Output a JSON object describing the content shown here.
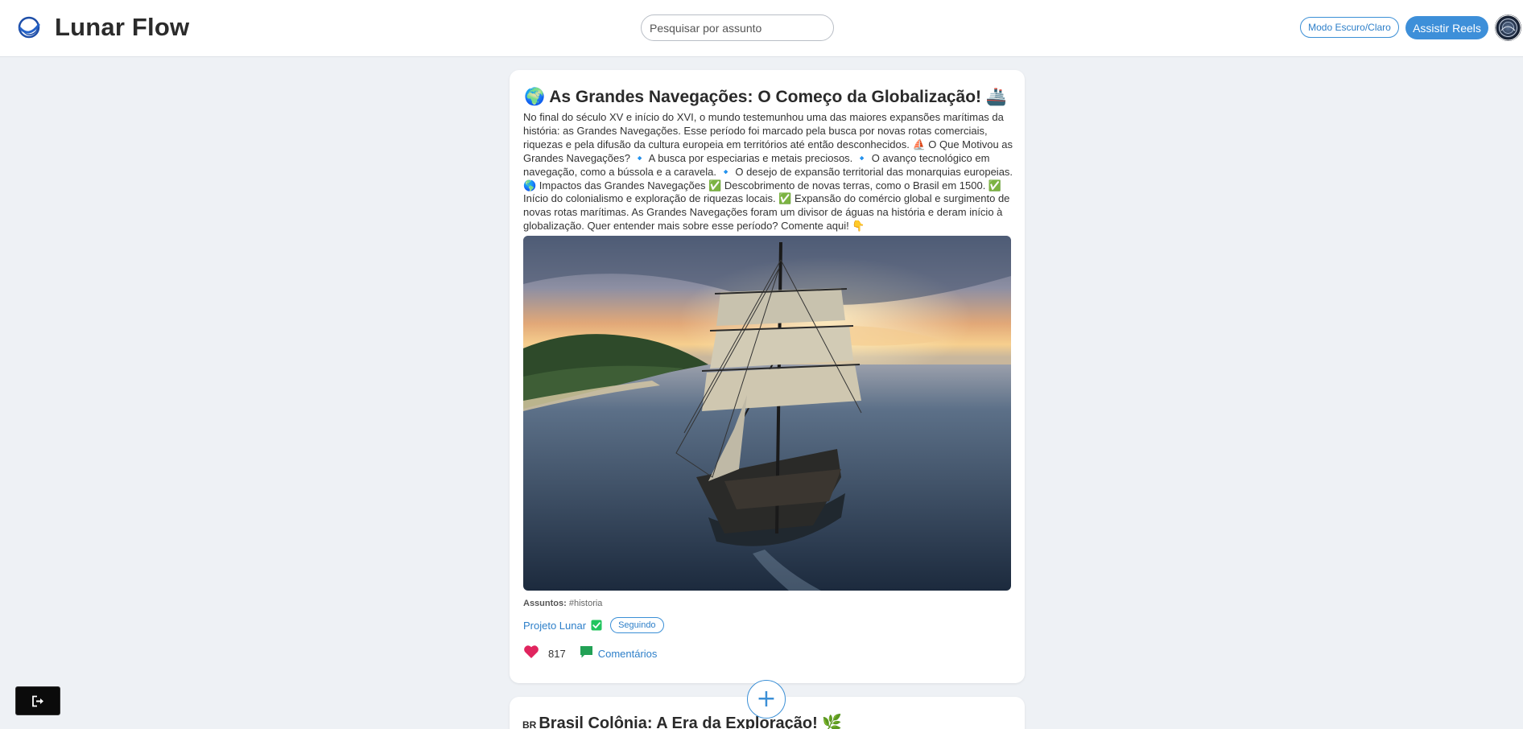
{
  "header": {
    "app_name": "Lunar Flow",
    "search_placeholder": "Pesquisar por assunto",
    "theme_toggle_label": "Modo Escuro/Claro",
    "reels_label": "Assistir Reels"
  },
  "post": {
    "title": "🌍 As Grandes Navegações: O Começo da Globalização! 🚢",
    "body": "No final do século XV e início do XVI, o mundo testemunhou uma das maiores expansões marítimas da história: as Grandes Navegações. Esse período foi marcado pela busca por novas rotas comerciais, riquezas e pela difusão da cultura europeia em territórios até então desconhecidos. ⛵ O Que Motivou as Grandes Navegações? 🔹 A busca por especiarias e metais preciosos. 🔹 O avanço tecnológico em navegação, como a bússola e a caravela. 🔹 O desejo de expansão territorial das monarquias europeias. 🌎 Impactos das Grandes Navegações ✅ Descobrimento de novas terras, como o Brasil em 1500. ✅ Início do colonialismo e exploração de riquezas locais. ✅ Expansão do comércio global e surgimento de novas rotas marítimas. As Grandes Navegações foram um divisor de águas na história e deram início à globalização. Quer entender mais sobre esse período? Comente aqui! 👇",
    "subjects_label": "Assuntos:",
    "subjects_value": "#historia",
    "author": "Projeto Lunar",
    "follow_label": "Seguindo",
    "likes": "817",
    "comments_label": "Comentários"
  },
  "next_post": {
    "flag": "BR",
    "title": "Brasil Colônia: A Era da Exploração! 🌿"
  },
  "fab_label": "+",
  "colors": {
    "accent": "#3d8fd9",
    "like": "#e0245e",
    "comment": "#22a155",
    "verified": "#22c55e",
    "background": "#eef1f5"
  },
  "icons": {
    "logo": "moon-logo-icon",
    "verified": "check-badge-icon",
    "like": "heart-icon",
    "comment": "speech-bubble-icon",
    "logout": "logout-icon",
    "add": "plus-icon"
  }
}
